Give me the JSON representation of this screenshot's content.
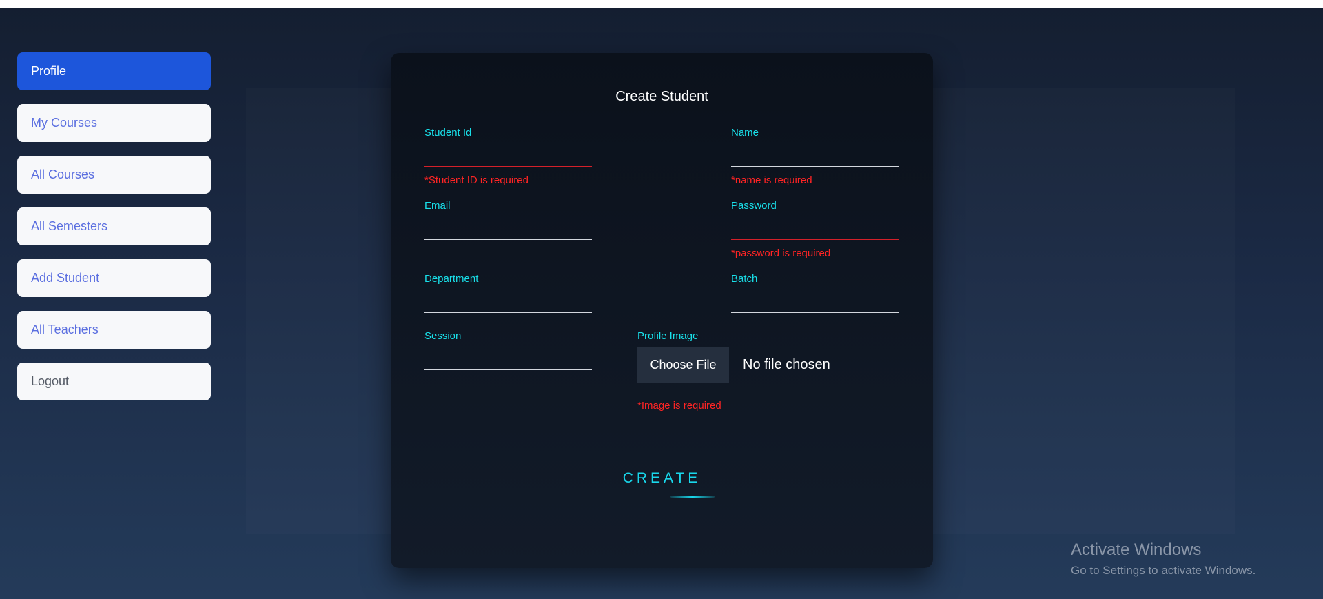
{
  "sidebar": {
    "items": [
      {
        "label": "Profile",
        "active": true
      },
      {
        "label": "My Courses"
      },
      {
        "label": "All Courses"
      },
      {
        "label": "All Semesters"
      },
      {
        "label": "Add Student"
      },
      {
        "label": "All Teachers"
      },
      {
        "label": "Logout"
      }
    ]
  },
  "form": {
    "title": "Create Student",
    "fields": {
      "student_id": {
        "label": "Student Id",
        "value": "",
        "error": "*Student ID is required"
      },
      "name": {
        "label": "Name",
        "value": "",
        "error": "*name is required"
      },
      "email": {
        "label": "Email",
        "value": ""
      },
      "password": {
        "label": "Password",
        "value": "",
        "error": "*password is required"
      },
      "department": {
        "label": "Department",
        "value": ""
      },
      "batch": {
        "label": "Batch",
        "value": ""
      },
      "session": {
        "label": "Session",
        "value": ""
      },
      "profile_image": {
        "label": "Profile Image",
        "button_label": "Choose File",
        "status": "No file chosen",
        "error": "*Image is required"
      }
    },
    "submit_label": "CREATE"
  },
  "watermark": {
    "title": "Activate Windows",
    "subtitle": "Go to Settings to activate Windows."
  },
  "colors": {
    "accent": "#19e0ea",
    "error": "#ff2424",
    "active_nav": "#1d56db",
    "nav_text": "#5b6fe0"
  }
}
